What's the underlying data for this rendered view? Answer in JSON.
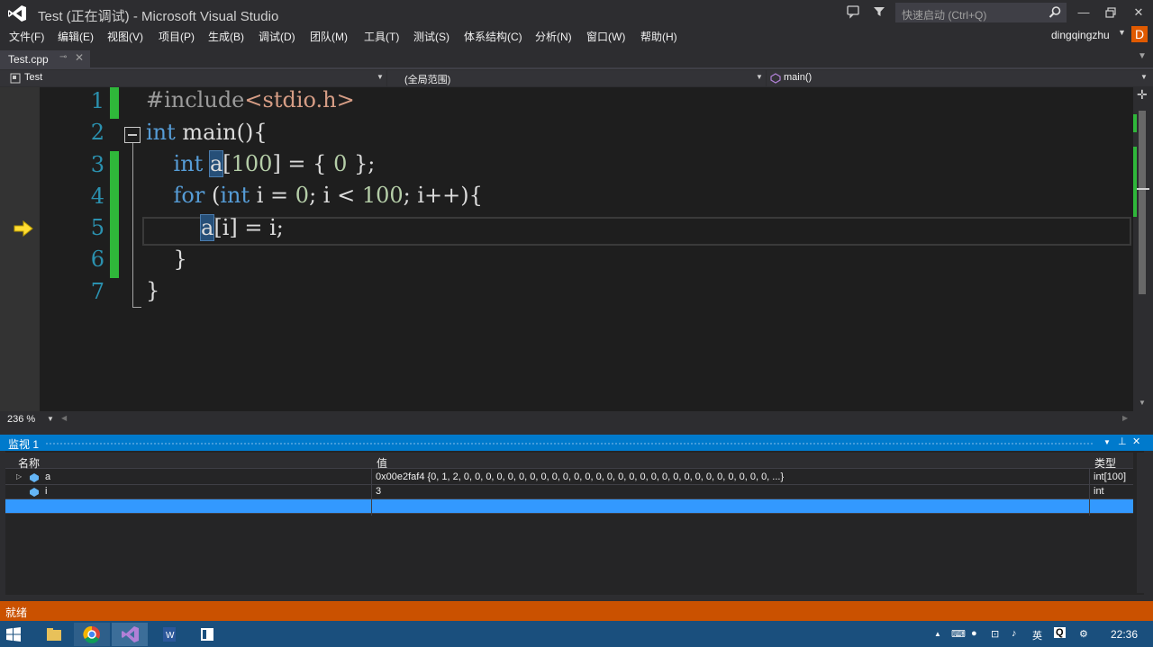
{
  "window": {
    "title": "Test (正在调试) - Microsoft Visual Studio",
    "quick_launch_placeholder": "快速启动 (Ctrl+Q)",
    "user": "dingqingzhu",
    "avatar_letter": "D"
  },
  "menu": {
    "items": [
      "文件(F)",
      "编辑(E)",
      "视图(V)",
      "项目(P)",
      "生成(B)",
      "调试(D)",
      "团队(M)",
      "工具(T)",
      "测试(S)",
      "体系结构(C)",
      "分析(N)",
      "窗口(W)",
      "帮助(H)"
    ]
  },
  "tab": {
    "label": "Test.cpp",
    "pin": "⊸",
    "close": "✕"
  },
  "navbar": {
    "project": "Test",
    "scope": "(全局范围)",
    "member": "main()"
  },
  "editor": {
    "line_numbers": [
      "1",
      "2",
      "3",
      "4",
      "5",
      "6",
      "7"
    ],
    "current_line": 5,
    "zoom": "236 %"
  },
  "watch": {
    "title": "监视 1",
    "columns": [
      "名称",
      "值",
      "类型"
    ],
    "rows": [
      {
        "name": "a",
        "value": "0x00e2faf4 {0, 1, 2, 0, 0, 0, 0, 0, 0, 0, 0, 0, 0, 0, 0, 0, 0, 0, 0, 0, 0, 0, 0, 0, 0, 0, 0, 0, 0, 0, 0, ...}",
        "type": "int[100]",
        "expandable": true
      },
      {
        "name": "i",
        "value": "3",
        "type": "int",
        "expandable": false
      }
    ]
  },
  "status": {
    "text": "就绪"
  },
  "taskbar": {
    "clock": "22:36",
    "ime": "英"
  },
  "colors": {
    "accent": "#007acc",
    "status_debug": "#ca5100",
    "change_bar": "#2fb73a",
    "keyword": "#569cd6",
    "string": "#d69d85",
    "number": "#b5cea8"
  }
}
